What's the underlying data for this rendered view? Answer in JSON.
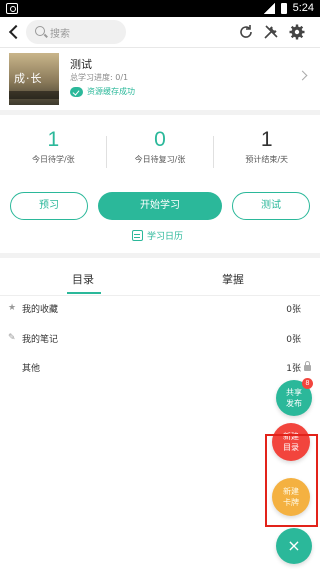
{
  "status_bar": {
    "time": "5:24"
  },
  "topbar": {
    "search_placeholder": "搜索",
    "icons": [
      "back-icon",
      "search-icon",
      "refresh-icon",
      "tools-icon",
      "gear-icon"
    ]
  },
  "book": {
    "cover_text": "成·长",
    "title": "测试",
    "progress": "总学习进度: 0/1",
    "status": "资源缓存成功"
  },
  "stats": [
    {
      "value": "1",
      "label": "今日待学/张"
    },
    {
      "value": "0",
      "label": "今日待复习/张"
    },
    {
      "value": "1",
      "label": "预计结束/天"
    }
  ],
  "actions": {
    "preview": "预习",
    "start": "开始学习",
    "test": "测试",
    "calendar": "学习日历"
  },
  "tabs": [
    "目录",
    "掌握"
  ],
  "list": [
    {
      "label": "我的收藏",
      "count": "0张",
      "icon": "star-icon"
    },
    {
      "label": "我的笔记",
      "count": "0张",
      "icon": "note-icon"
    },
    {
      "label": "其他",
      "count": "1张",
      "icon": "lock-icon"
    }
  ],
  "fabs": {
    "share": "共享发布",
    "share_badge": "8",
    "new_dir": "新建目录",
    "new_card": "新建卡牌",
    "close": "×"
  },
  "colors": {
    "accent": "#2bb89a",
    "red": "#f2453d",
    "orange": "#f4b141",
    "highlight": "#e2231a"
  }
}
